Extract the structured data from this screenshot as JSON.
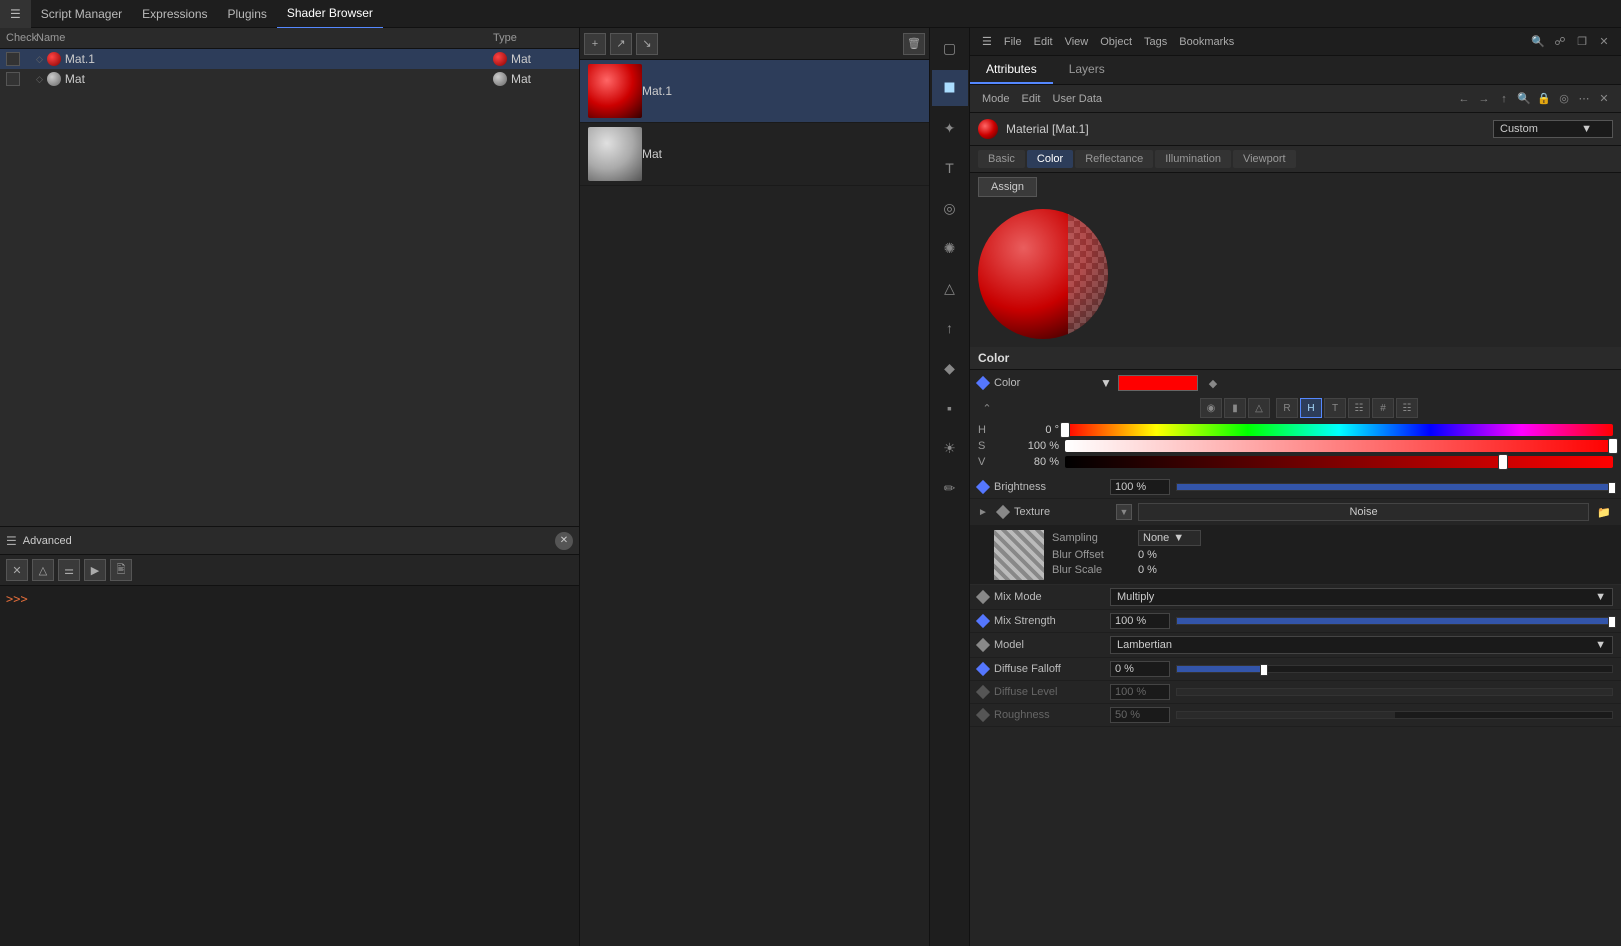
{
  "app": {
    "title": "Script Manager"
  },
  "topMenuBar": {
    "items": [
      {
        "id": "script-manager",
        "label": "Script Manager",
        "active": false
      },
      {
        "id": "expressions",
        "label": "Expressions",
        "active": false
      },
      {
        "id": "plugins",
        "label": "Plugins",
        "active": false
      },
      {
        "id": "shader-browser",
        "label": "Shader Browser",
        "active": true
      }
    ]
  },
  "rightTopBar": {
    "items": [
      "File",
      "Edit",
      "View",
      "Object",
      "Tags",
      "Bookmarks"
    ]
  },
  "materialList": {
    "header": {
      "check": "Check",
      "name": "Name",
      "type": "Type"
    },
    "rows": [
      {
        "id": "mat1",
        "name": "Mat.1",
        "type": "Mat",
        "selected": true
      },
      {
        "id": "mat",
        "name": "Mat",
        "type": "Mat",
        "selected": false
      }
    ]
  },
  "advanced": {
    "title": "Advanced",
    "console_prompt": ">>>"
  },
  "shaderBrowser": {
    "items": [
      {
        "id": "mat1",
        "label": "Mat.1",
        "selected": true,
        "type": "red"
      },
      {
        "id": "mat",
        "label": "Mat",
        "selected": false,
        "type": "gray"
      }
    ]
  },
  "attributes": {
    "title": "Attributes",
    "tabs": [
      {
        "id": "attributes",
        "label": "Attributes",
        "active": true
      },
      {
        "id": "layers",
        "label": "Layers",
        "active": false
      }
    ],
    "toolbar": {
      "mode": "Mode",
      "edit": "Edit",
      "userData": "User Data"
    },
    "material": {
      "name": "Material [Mat.1]",
      "preset": "Custom"
    },
    "subTabs": [
      {
        "id": "basic",
        "label": "Basic",
        "active": false
      },
      {
        "id": "color",
        "label": "Color",
        "active": true
      },
      {
        "id": "reflectance",
        "label": "Reflectance",
        "active": false
      },
      {
        "id": "illumination",
        "label": "Illumination",
        "active": false
      },
      {
        "id": "viewport",
        "label": "Viewport",
        "active": false
      }
    ],
    "assignBtn": "Assign",
    "colorSection": {
      "title": "Color",
      "colorLabel": "Color",
      "colorValue": "#ff0000",
      "hsvRows": [
        {
          "label": "H",
          "value": "0 °",
          "pct": 0
        },
        {
          "label": "S",
          "value": "100 %",
          "pct": 100
        },
        {
          "label": "V",
          "value": "80 %",
          "pct": 80
        }
      ]
    },
    "properties": [
      {
        "id": "brightness",
        "label": "Brightness",
        "value": "100 %",
        "pct": 100,
        "disabled": false
      },
      {
        "id": "texture",
        "label": "Texture",
        "value": "Noise",
        "type": "texture"
      },
      {
        "id": "sampling",
        "label": "Sampling",
        "value": "None",
        "type": "sub"
      },
      {
        "id": "blur-offset",
        "label": "Blur Offset",
        "value": "0 %",
        "pct": 0,
        "type": "sub"
      },
      {
        "id": "blur-scale",
        "label": "Blur Scale",
        "value": "0 %",
        "pct": 0,
        "type": "sub"
      },
      {
        "id": "mix-mode",
        "label": "Mix Mode",
        "value": "Multiply",
        "type": "dropdown"
      },
      {
        "id": "mix-strength",
        "label": "Mix Strength",
        "value": "100 %",
        "pct": 100
      },
      {
        "id": "model",
        "label": "Model",
        "value": "Lambertian",
        "type": "dropdown"
      },
      {
        "id": "diffuse-falloff",
        "label": "Diffuse Falloff",
        "value": "0 %",
        "pct": 0
      },
      {
        "id": "diffuse-level",
        "label": "Diffuse Level",
        "value": "100 %",
        "pct": 100,
        "disabled": true
      },
      {
        "id": "roughness",
        "label": "Roughness",
        "value": "50 %",
        "pct": 50,
        "disabled": true
      }
    ]
  }
}
